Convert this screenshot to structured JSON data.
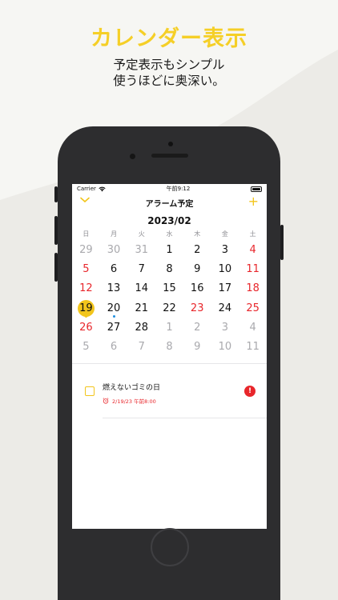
{
  "promo": {
    "headline": "カレンダー表示",
    "subline1": "予定表示もシンプル",
    "subline2": "使うほどに奥深い。"
  },
  "status_bar": {
    "carrier": "Carrier",
    "time": "午前9:12"
  },
  "nav": {
    "title": "アラーム予定",
    "add_label": "+"
  },
  "calendar": {
    "month_label": "2023/02",
    "weekdays": [
      "日",
      "月",
      "火",
      "水",
      "木",
      "金",
      "土"
    ],
    "weeks": [
      [
        "29",
        "30",
        "31",
        "1",
        "2",
        "3",
        "4"
      ],
      [
        "5",
        "6",
        "7",
        "8",
        "9",
        "10",
        "11"
      ],
      [
        "12",
        "13",
        "14",
        "15",
        "16",
        "17",
        "18"
      ],
      [
        "19",
        "20",
        "21",
        "22",
        "23",
        "24",
        "25"
      ],
      [
        "26",
        "27",
        "28",
        "1",
        "2",
        "3",
        "4"
      ],
      [
        "5",
        "6",
        "7",
        "8",
        "9",
        "10",
        "11"
      ]
    ],
    "today": "19",
    "colors": {
      "accent": "#f2c51b",
      "holiday": "#e8262b",
      "event_dot_today": "#f2c51b",
      "event_dot": "#1f8fe0"
    }
  },
  "event": {
    "title": "燃えないゴミの日",
    "datetime": "2/19/23 午前8:00",
    "alert_badge": "!"
  }
}
